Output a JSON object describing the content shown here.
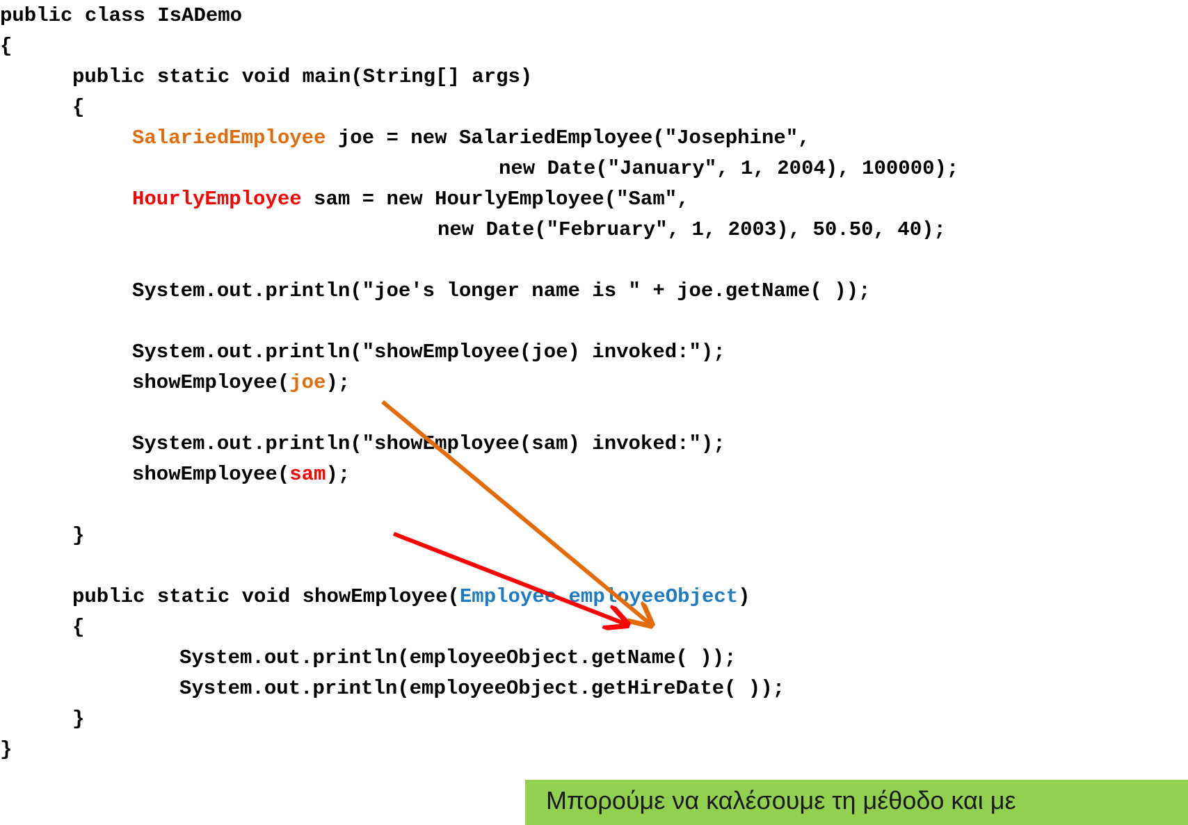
{
  "code": {
    "class_decl": "public class IsADemo",
    "open_brace_class": "{",
    "main_decl": "public static void main(String[] args)",
    "open_brace_main": "{",
    "joe_type": "SalariedEmployee",
    "joe_decl_rest": " joe = new SalariedEmployee(\"Josephine\",",
    "joe_decl_cont": "new Date(\"January\", 1, 2004), 100000);",
    "sam_type": "HourlyEmployee",
    "sam_decl_rest": " sam = new HourlyEmployee(\"Sam\",",
    "sam_decl_cont": "new Date(\"February\", 1, 2003), 50.50, 40);",
    "print_longer_name": "System.out.println(\"joe's longer name is \" + joe.getName( ));",
    "print_show_joe": "System.out.println(\"showEmployee(joe) invoked:\");",
    "call_joe_prefix": "showEmployee(",
    "call_joe_arg": "joe",
    "call_joe_suffix": ");",
    "print_show_sam": "System.out.println(\"showEmployee(sam) invoked:\");",
    "call_sam_prefix": "showEmployee(",
    "call_sam_arg": "sam",
    "call_sam_suffix": ");",
    "close_brace_main": "}",
    "show_decl_prefix": "public static void showEmployee(",
    "show_decl_param": "Employee employeeObject",
    "show_decl_suffix": ")",
    "open_brace_show": "{",
    "print_get_name": "System.out.println(employeeObject.getName( ));",
    "print_get_hire_date": "System.out.println(employeeObject.getHireDate( ));",
    "close_brace_show": "}",
    "close_brace_class": "}"
  },
  "note": {
    "text": "Μπορούμε να καλέσουμε τη μέθοδο και με"
  },
  "colors": {
    "salaried": "#e36c0a",
    "hourly": "#ff0000",
    "employee": "#1f7bc1",
    "note_background": "#92d050"
  }
}
